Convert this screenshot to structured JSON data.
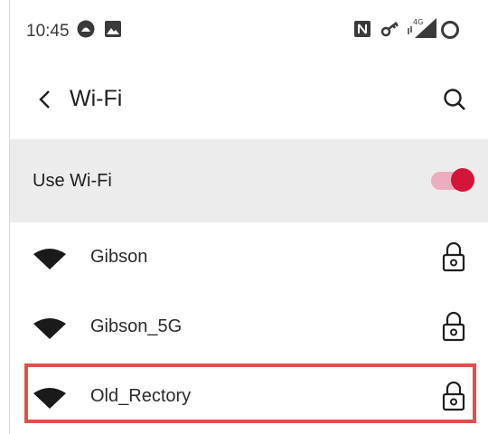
{
  "status_bar": {
    "time": "10:45",
    "icons": [
      "app-notification-icon",
      "image-icon",
      "nfc-icon",
      "vpn-key-icon",
      "4g-signal-icon",
      "battery-ring-icon"
    ],
    "network_label": "4G"
  },
  "header": {
    "title": "Wi-Fi",
    "back_icon": "back-arrow-icon",
    "search_icon": "search-icon"
  },
  "wifi_master": {
    "label": "Use Wi-Fi",
    "enabled": true,
    "accent_color": "#d4153a"
  },
  "networks": [
    {
      "name": "Gibson",
      "secured": true
    },
    {
      "name": "Gibson_5G",
      "secured": true
    },
    {
      "name": "Old_Rectory",
      "secured": true,
      "highlighted": true
    }
  ],
  "colors": {
    "highlight_border": "#e0504a",
    "master_row_bg": "#ececec"
  }
}
